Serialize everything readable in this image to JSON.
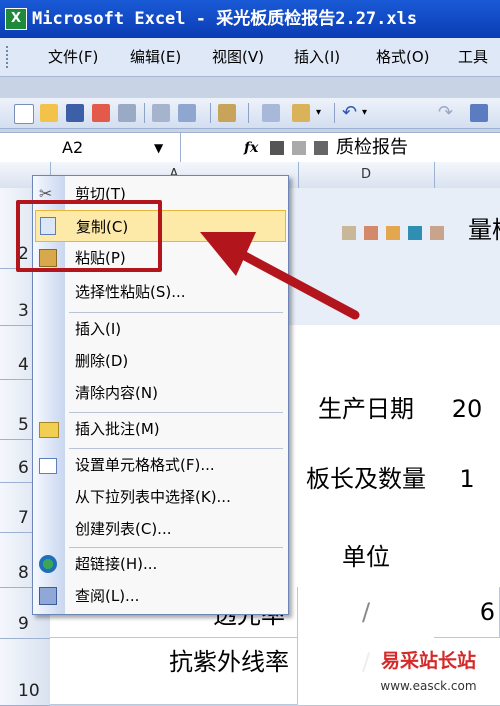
{
  "window": {
    "app_icon": "excel-icon",
    "title": "Microsoft Excel - 采光板质检报告2.27.xls"
  },
  "menubar": {
    "items": [
      "文件(F)",
      "编辑(E)",
      "视图(V)",
      "插入(I)",
      "格式(O)",
      "工具"
    ]
  },
  "toolbar": {
    "icons": [
      "new-icon",
      "open-icon",
      "save-icon",
      "permission-icon",
      "print-icon",
      "print-preview-icon",
      "spellcheck-icon",
      "cut-icon",
      "copy-icon",
      "paste-icon",
      "undo-icon",
      "redo-icon"
    ]
  },
  "formula_bar": {
    "name_box": "A2",
    "fx": "fx",
    "content": "质检报告"
  },
  "column_headers": [
    "A",
    "D"
  ],
  "row_headers": [
    "2",
    "3",
    "4",
    "5",
    "6",
    "7",
    "8",
    "9",
    "10"
  ],
  "cells": {
    "r2_title_fragment": "量检",
    "r5_label": "生产日期",
    "r5_value": "20",
    "r67_label": "板长及数量",
    "r67_value": "1",
    "r8_label": "单位",
    "r9_a": "透光率",
    "r9_d": "/",
    "r9_e": "6",
    "r10_a": "抗紫外线率",
    "r10_d": "/"
  },
  "context_menu": {
    "items": [
      {
        "label": "剪切(T)",
        "icon": "scissors-icon"
      },
      {
        "label": "复制(C)",
        "icon": "copy-icon",
        "highlighted": true
      },
      {
        "label": "粘贴(P)",
        "icon": "paste-icon"
      },
      {
        "label": "选择性粘贴(S)...",
        "icon": ""
      },
      {
        "label": "插入(I)",
        "icon": ""
      },
      {
        "label": "删除(D)",
        "icon": ""
      },
      {
        "label": "清除内容(N)",
        "icon": ""
      },
      {
        "label": "插入批注(M)",
        "icon": "comment-icon"
      },
      {
        "label": "设置单元格格式(F)...",
        "icon": "format-cells-icon"
      },
      {
        "label": "从下拉列表中选择(K)...",
        "icon": ""
      },
      {
        "label": "创建列表(C)...",
        "icon": ""
      },
      {
        "label": "超链接(H)...",
        "icon": "hyperlink-icon"
      },
      {
        "label": "查阅(L)...",
        "icon": "research-icon"
      }
    ]
  },
  "watermark": {
    "line1": "易采站长站",
    "line2": "www.easck.com"
  },
  "colors": {
    "annotation_red": "#b3151d",
    "highlight": "#fde9a8",
    "titlebar_blue": "#0a3cb4"
  }
}
